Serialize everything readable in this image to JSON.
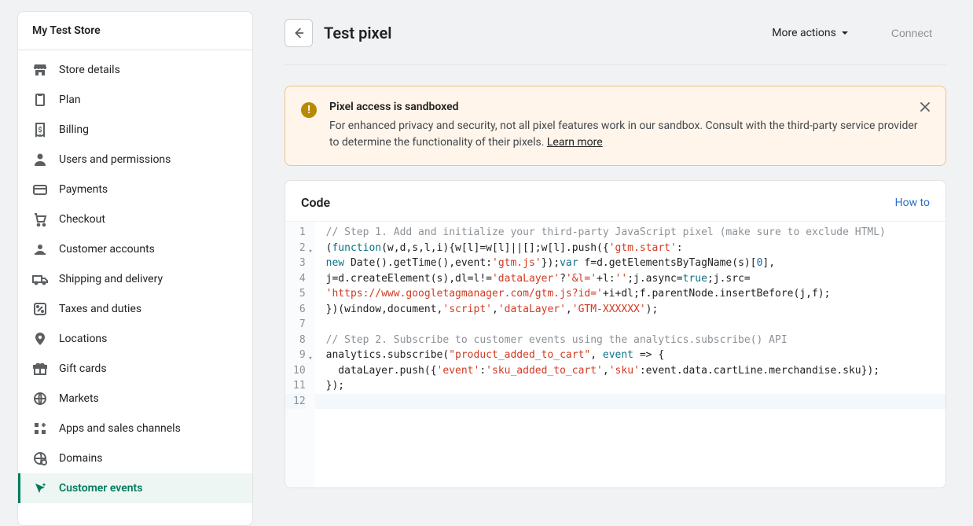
{
  "store_name": "My Test Store",
  "sidebar": {
    "items": [
      {
        "id": "store-details",
        "label": "Store details",
        "icon": "storefront"
      },
      {
        "id": "plan",
        "label": "Plan",
        "icon": "clipboard"
      },
      {
        "id": "billing",
        "label": "Billing",
        "icon": "receipt"
      },
      {
        "id": "users",
        "label": "Users and permissions",
        "icon": "person"
      },
      {
        "id": "payments",
        "label": "Payments",
        "icon": "card"
      },
      {
        "id": "checkout",
        "label": "Checkout",
        "icon": "cart"
      },
      {
        "id": "customer-accounts",
        "label": "Customer accounts",
        "icon": "profile"
      },
      {
        "id": "shipping",
        "label": "Shipping and delivery",
        "icon": "truck"
      },
      {
        "id": "taxes",
        "label": "Taxes and duties",
        "icon": "percent"
      },
      {
        "id": "locations",
        "label": "Locations",
        "icon": "pin"
      },
      {
        "id": "gift-cards",
        "label": "Gift cards",
        "icon": "gift"
      },
      {
        "id": "markets",
        "label": "Markets",
        "icon": "globe"
      },
      {
        "id": "apps",
        "label": "Apps and sales channels",
        "icon": "grid-plus"
      },
      {
        "id": "domains",
        "label": "Domains",
        "icon": "globe-cog"
      },
      {
        "id": "customer-events",
        "label": "Customer events",
        "icon": "cursor-sparkle",
        "active": true
      }
    ]
  },
  "header": {
    "title": "Test pixel",
    "more_actions_label": "More actions",
    "connect_label": "Connect"
  },
  "banner": {
    "title": "Pixel access is sandboxed",
    "body": "For enhanced privacy and security, not all pixel features work in our sandbox. Consult with the third-party service provider to determine the functionality of their pixels. ",
    "learn_more": "Learn more"
  },
  "code_section": {
    "title": "Code",
    "how_to": "How to"
  },
  "code": {
    "lines": [
      {
        "n": 1,
        "tokens": [
          {
            "t": "// Step 1. Add and initialize your third-party JavaScript pixel (make sure to exclude HTML)",
            "c": "comment"
          }
        ]
      },
      {
        "n": 2,
        "fold": true,
        "tokens": [
          {
            "t": "(",
            "c": "punc"
          },
          {
            "t": "function",
            "c": "kw"
          },
          {
            "t": "(w,d,s,l,i){w[l]=w[l]||[];w[l].push({",
            "c": "punc"
          },
          {
            "t": "'gtm.start'",
            "c": "str"
          },
          {
            "t": ":",
            "c": "punc"
          }
        ]
      },
      {
        "n": 3,
        "tokens": [
          {
            "t": "new",
            "c": "kw"
          },
          {
            "t": " ",
            "c": "punc"
          },
          {
            "t": "Date",
            "c": "fn"
          },
          {
            "t": "().getTime(),event:",
            "c": "punc"
          },
          {
            "t": "'gtm.js'",
            "c": "str"
          },
          {
            "t": "});",
            "c": "punc"
          },
          {
            "t": "var",
            "c": "kw"
          },
          {
            "t": " f=d.getElementsByTagName(s)[",
            "c": "punc"
          },
          {
            "t": "0",
            "c": "num"
          },
          {
            "t": "],",
            "c": "punc"
          }
        ]
      },
      {
        "n": 4,
        "tokens": [
          {
            "t": "j=d.createElement(s),dl=l!=",
            "c": "punc"
          },
          {
            "t": "'dataLayer'",
            "c": "str"
          },
          {
            "t": "?",
            "c": "punc"
          },
          {
            "t": "'&l='",
            "c": "str"
          },
          {
            "t": "+l:",
            "c": "punc"
          },
          {
            "t": "''",
            "c": "str"
          },
          {
            "t": ";j.async=",
            "c": "punc"
          },
          {
            "t": "true",
            "c": "kw"
          },
          {
            "t": ";j.src=",
            "c": "punc"
          }
        ]
      },
      {
        "n": 5,
        "tokens": [
          {
            "t": "'https://www.googletagmanager.com/gtm.js?id='",
            "c": "str"
          },
          {
            "t": "+i+dl;f.parentNode.insertBefore(j,f);",
            "c": "punc"
          }
        ]
      },
      {
        "n": 6,
        "tokens": [
          {
            "t": "})(window,document,",
            "c": "punc"
          },
          {
            "t": "'script'",
            "c": "str"
          },
          {
            "t": ",",
            "c": "punc"
          },
          {
            "t": "'dataLayer'",
            "c": "str"
          },
          {
            "t": ",",
            "c": "punc"
          },
          {
            "t": "'GTM-XXXXXX'",
            "c": "str"
          },
          {
            "t": ");",
            "c": "punc"
          }
        ]
      },
      {
        "n": 7,
        "tokens": [
          {
            "t": "",
            "c": "punc"
          }
        ]
      },
      {
        "n": 8,
        "tokens": [
          {
            "t": "// Step 2. Subscribe to customer events using the analytics.subscribe() API",
            "c": "comment"
          }
        ]
      },
      {
        "n": 9,
        "fold": true,
        "tokens": [
          {
            "t": "analytics.subscribe(",
            "c": "punc"
          },
          {
            "t": "\"product_added_to_cart\"",
            "c": "str"
          },
          {
            "t": ", ",
            "c": "punc"
          },
          {
            "t": "event",
            "c": "kw"
          },
          {
            "t": " => {",
            "c": "punc"
          }
        ]
      },
      {
        "n": 10,
        "tokens": [
          {
            "t": "  dataLayer.push({",
            "c": "punc"
          },
          {
            "t": "'event'",
            "c": "str"
          },
          {
            "t": ":",
            "c": "punc"
          },
          {
            "t": "'sku_added_to_cart'",
            "c": "str"
          },
          {
            "t": ",",
            "c": "punc"
          },
          {
            "t": "'sku'",
            "c": "str"
          },
          {
            "t": ":event.data.cartLine.merchandise.sku});",
            "c": "punc"
          }
        ]
      },
      {
        "n": 11,
        "tokens": [
          {
            "t": "});",
            "c": "punc"
          }
        ]
      },
      {
        "n": 12,
        "hl": true,
        "tokens": [
          {
            "t": "",
            "c": "punc"
          }
        ]
      }
    ]
  }
}
